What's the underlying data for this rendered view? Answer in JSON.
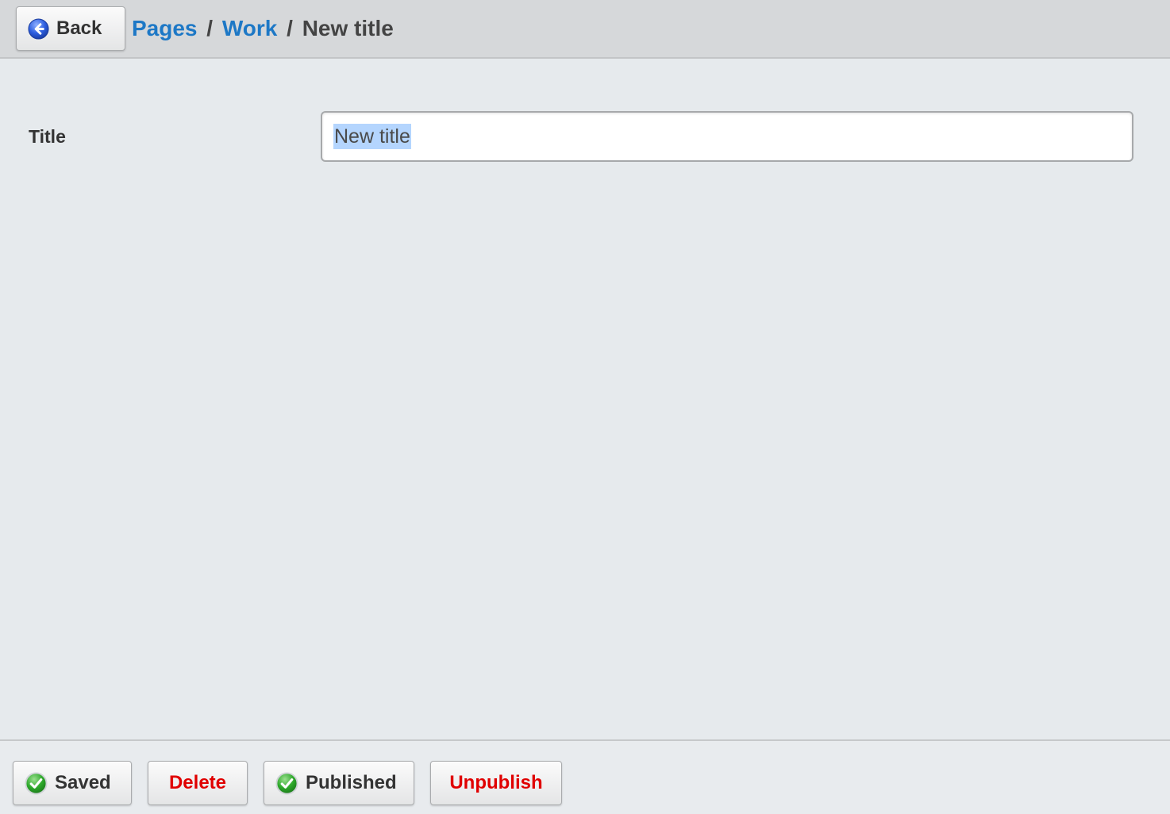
{
  "header": {
    "back_label": "Back",
    "breadcrumb": {
      "items": [
        "Pages",
        "Work"
      ],
      "separator": "/",
      "current": "New title"
    }
  },
  "form": {
    "title_label": "Title",
    "title_value": "New title"
  },
  "footer": {
    "saved_label": "Saved",
    "delete_label": "Delete",
    "published_label": "Published",
    "unpublish_label": "Unpublish"
  },
  "colors": {
    "link": "#1d78c6",
    "danger": "#e00000",
    "selection": "#b4d5fe",
    "header_bg": "#d6d8da",
    "page_bg": "#e6eaed"
  },
  "icons": {
    "back": "arrow-left-circle-icon",
    "saved": "check-circle-icon",
    "published": "check-circle-icon"
  }
}
